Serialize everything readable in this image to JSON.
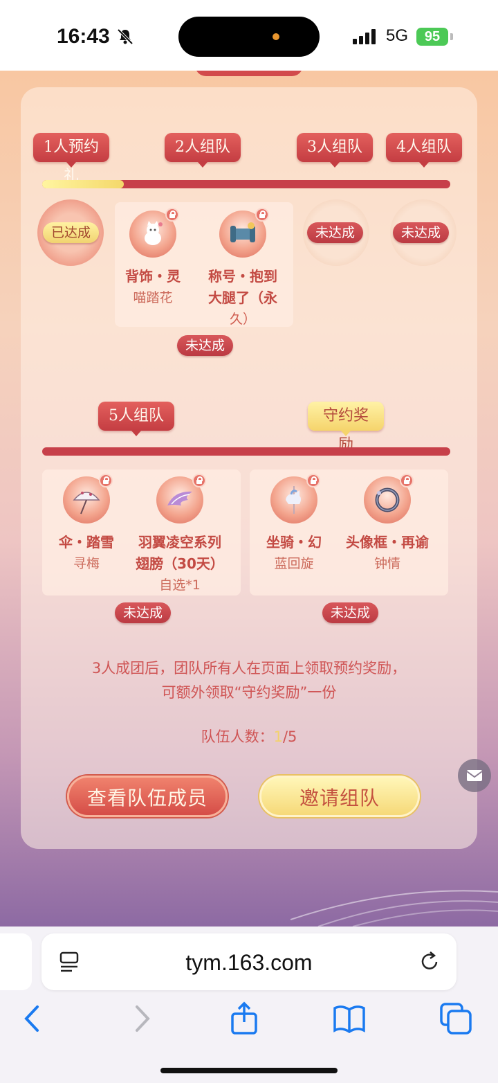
{
  "status_bar": {
    "time": "16:43",
    "network": "5G",
    "battery": "95"
  },
  "milestones": {
    "tags": [
      "1人预约礼",
      "2人组队",
      "3人组队",
      "4人组队"
    ],
    "progress_fraction": 0.2,
    "medal_done": "已达成",
    "medal_pending_3": "未达成",
    "medal_pending_4": "未达成",
    "rewards": [
      {
        "name": "背饰・灵",
        "sub": "喵踏花",
        "icon": "cat-pet-icon"
      },
      {
        "name": "称号・抱到",
        "sub": "大腿了（永",
        "sub2": "久）",
        "icon": "scroll-title-icon"
      }
    ],
    "status_2": "未达成"
  },
  "section2": {
    "tags": [
      "5人组队",
      "守约奖励"
    ],
    "rewards_5": [
      {
        "name": "伞・踏雪",
        "sub": "寻梅",
        "icon": "umbrella-icon"
      },
      {
        "name": "羽翼凌空系列",
        "sub": "翅膀（30天）",
        "sub2": "自选*1",
        "icon": "wings-icon"
      }
    ],
    "rewards_promise": [
      {
        "name": "坐骑・幻",
        "sub": "蓝回旋",
        "icon": "carousel-horse-icon"
      },
      {
        "name": "头像框・再谕",
        "sub": "钟情",
        "icon": "avatar-frame-icon"
      }
    ],
    "status_5": "未达成",
    "status_promise": "未达成"
  },
  "info": {
    "line1": "3人成团后，团队所有人在页面上领取预约奖励，",
    "line2": "可额外领取“守约奖励”一份"
  },
  "team_count": {
    "label": "队伍人数：",
    "current": "1",
    "sep": "/",
    "total": "5"
  },
  "buttons": {
    "view_members": "查看队伍成员",
    "invite": "邀请组队"
  },
  "browser": {
    "url": "tym.163.com"
  },
  "colors": {
    "accent_red": "#c7404a",
    "gold": "#f5d46c"
  }
}
